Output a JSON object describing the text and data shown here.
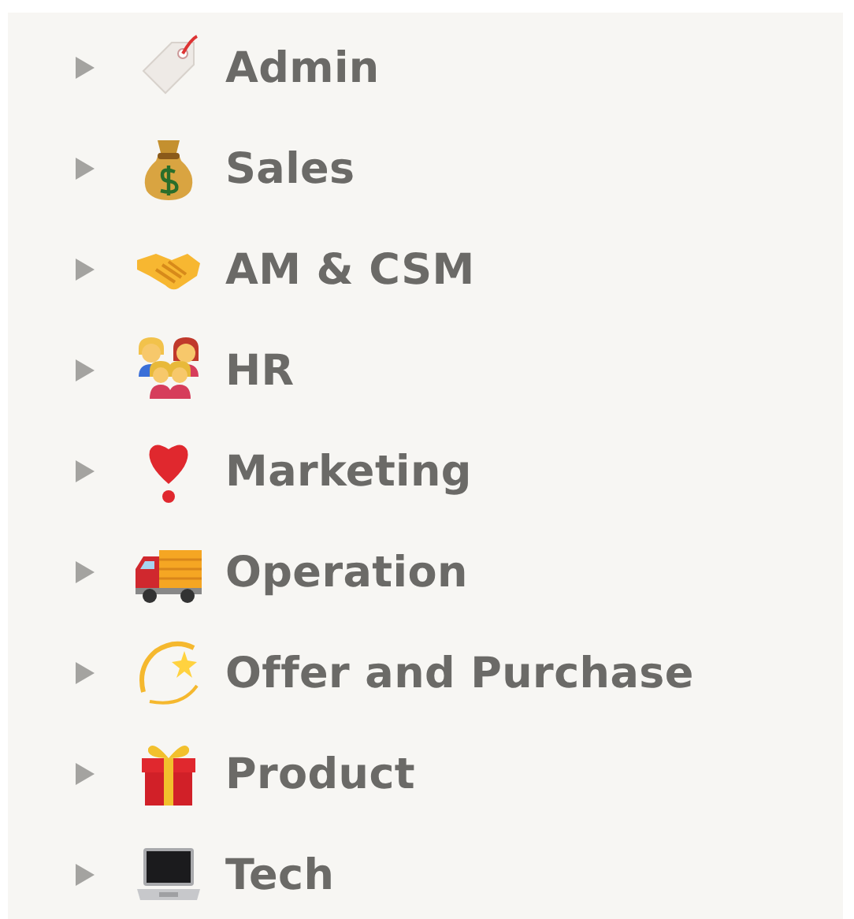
{
  "sidebar": {
    "items": [
      {
        "label": "Admin",
        "expanded": false
      },
      {
        "label": "Sales",
        "expanded": false
      },
      {
        "label": "AM & CSM",
        "expanded": false
      },
      {
        "label": "HR",
        "expanded": false
      },
      {
        "label": "Marketing",
        "expanded": false
      },
      {
        "label": "Operation",
        "expanded": false
      },
      {
        "label": "Offer and Purchase",
        "expanded": false
      },
      {
        "label": "Product",
        "expanded": false
      },
      {
        "label": "Tech",
        "expanded": false
      }
    ]
  }
}
